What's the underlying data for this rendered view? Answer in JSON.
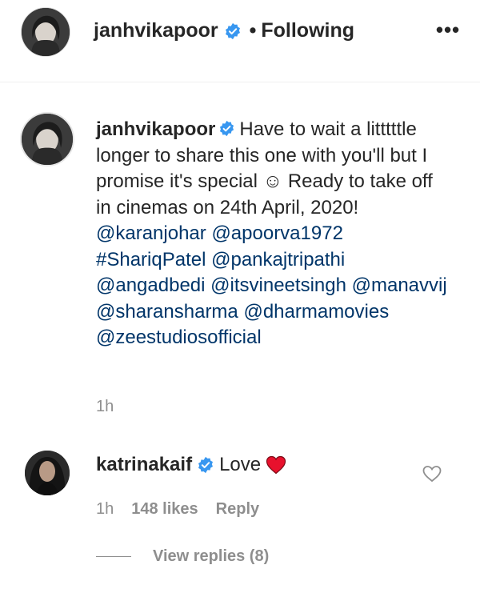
{
  "header": {
    "username": "janhvikapoor",
    "separator": "•",
    "follow_status": "Following",
    "more_icon": "more-horizontal-icon",
    "more_label": "•••"
  },
  "caption": {
    "username": "janhvikapoor",
    "text": "Have to wait a litttttle longer to share this one with you'll but I promise it's special ☺ Ready to take off in cinemas on 24th April, 2020!",
    "tags": [
      "@karanjohar",
      "@apoorva1972",
      "#ShariqPatel",
      "@pankajtripathi",
      "@angadbedi",
      "@itsvineetsingh",
      "@manavvij",
      "@sharansharma",
      "@dharmamovies",
      "@zeestudiosofficial"
    ],
    "time": "1h"
  },
  "comment": {
    "username": "katrinakaif",
    "text": "Love",
    "emoji_icon": "red-heart-emoji-icon",
    "time": "1h",
    "likes": "148 likes",
    "reply_label": "Reply",
    "view_replies": "View replies (8)",
    "like_icon": "heart-outline-icon"
  },
  "colors": {
    "text": "#262626",
    "link": "#003569",
    "muted": "#8e8e8e",
    "verified": "#3897f0",
    "heart": "#ed4956",
    "divider": "#efefef"
  }
}
